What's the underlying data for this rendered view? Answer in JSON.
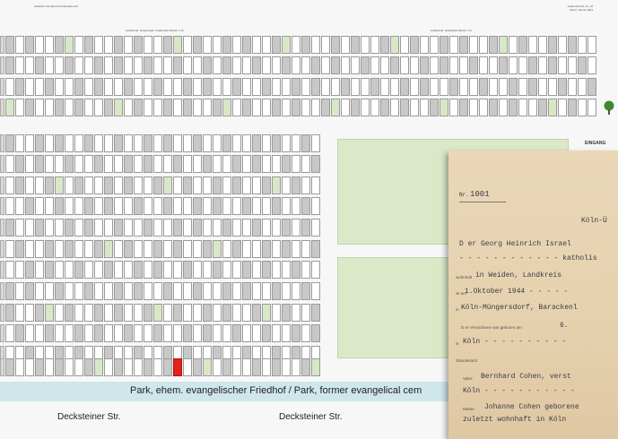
{
  "plan": {
    "header_left": "Jüdischer Friedhof Köln-Bocklemünd",
    "header_right_1": "Gräberfeld 30, 31, 32",
    "header_right_2": "Stand: Januar 2024",
    "section_left": "Gräberfeld: Jüngerwald / Gräberfeld Reihen 1-11",
    "section_right": "Gräberfeld: Gräberfeld Reihen 1-8",
    "entrance_label": "EINGANG",
    "park_label": "Park, ehem. evangelischer Friedhof / Park, former evangelical cem",
    "street_left": "Decksteiner Str.",
    "street_center": "Decksteiner Str.",
    "highlight_color": "#e0231c",
    "green_area_color": "#dbe9c9"
  },
  "document": {
    "number_prefix": "Nr.",
    "number": "1001",
    "place_header": "Köln-Ü",
    "line_1": "D er Georg Heinrich Israel",
    "line_2": "- - - - - - - - - - - - katholis",
    "line_3_label": "wohnhaft",
    "line_3": "in Weiden, Landkreis",
    "line_4_label": "ist am",
    "line_4": "1.Oktober 1944 - - - - -",
    "line_5_label": "in",
    "line_5": "Köln-Müngersdorf, Barackenl",
    "line_6_prefix": "D er Verstorbene war geboren am",
    "line_6": "6.",
    "line_7_label": "in",
    "line_7": "Köln - - - - - - - - - -",
    "line_8_label": "Standesamt",
    "line_9_label": "Vater:",
    "line_9": "Bernhard Cohen, verst",
    "line_10": "Köln - - - - - - - - - - -",
    "line_11_label": "Mutter:",
    "line_11": "Johanne Cohen geborene",
    "line_12": "zuletzt wohnhaft in Köln"
  }
}
